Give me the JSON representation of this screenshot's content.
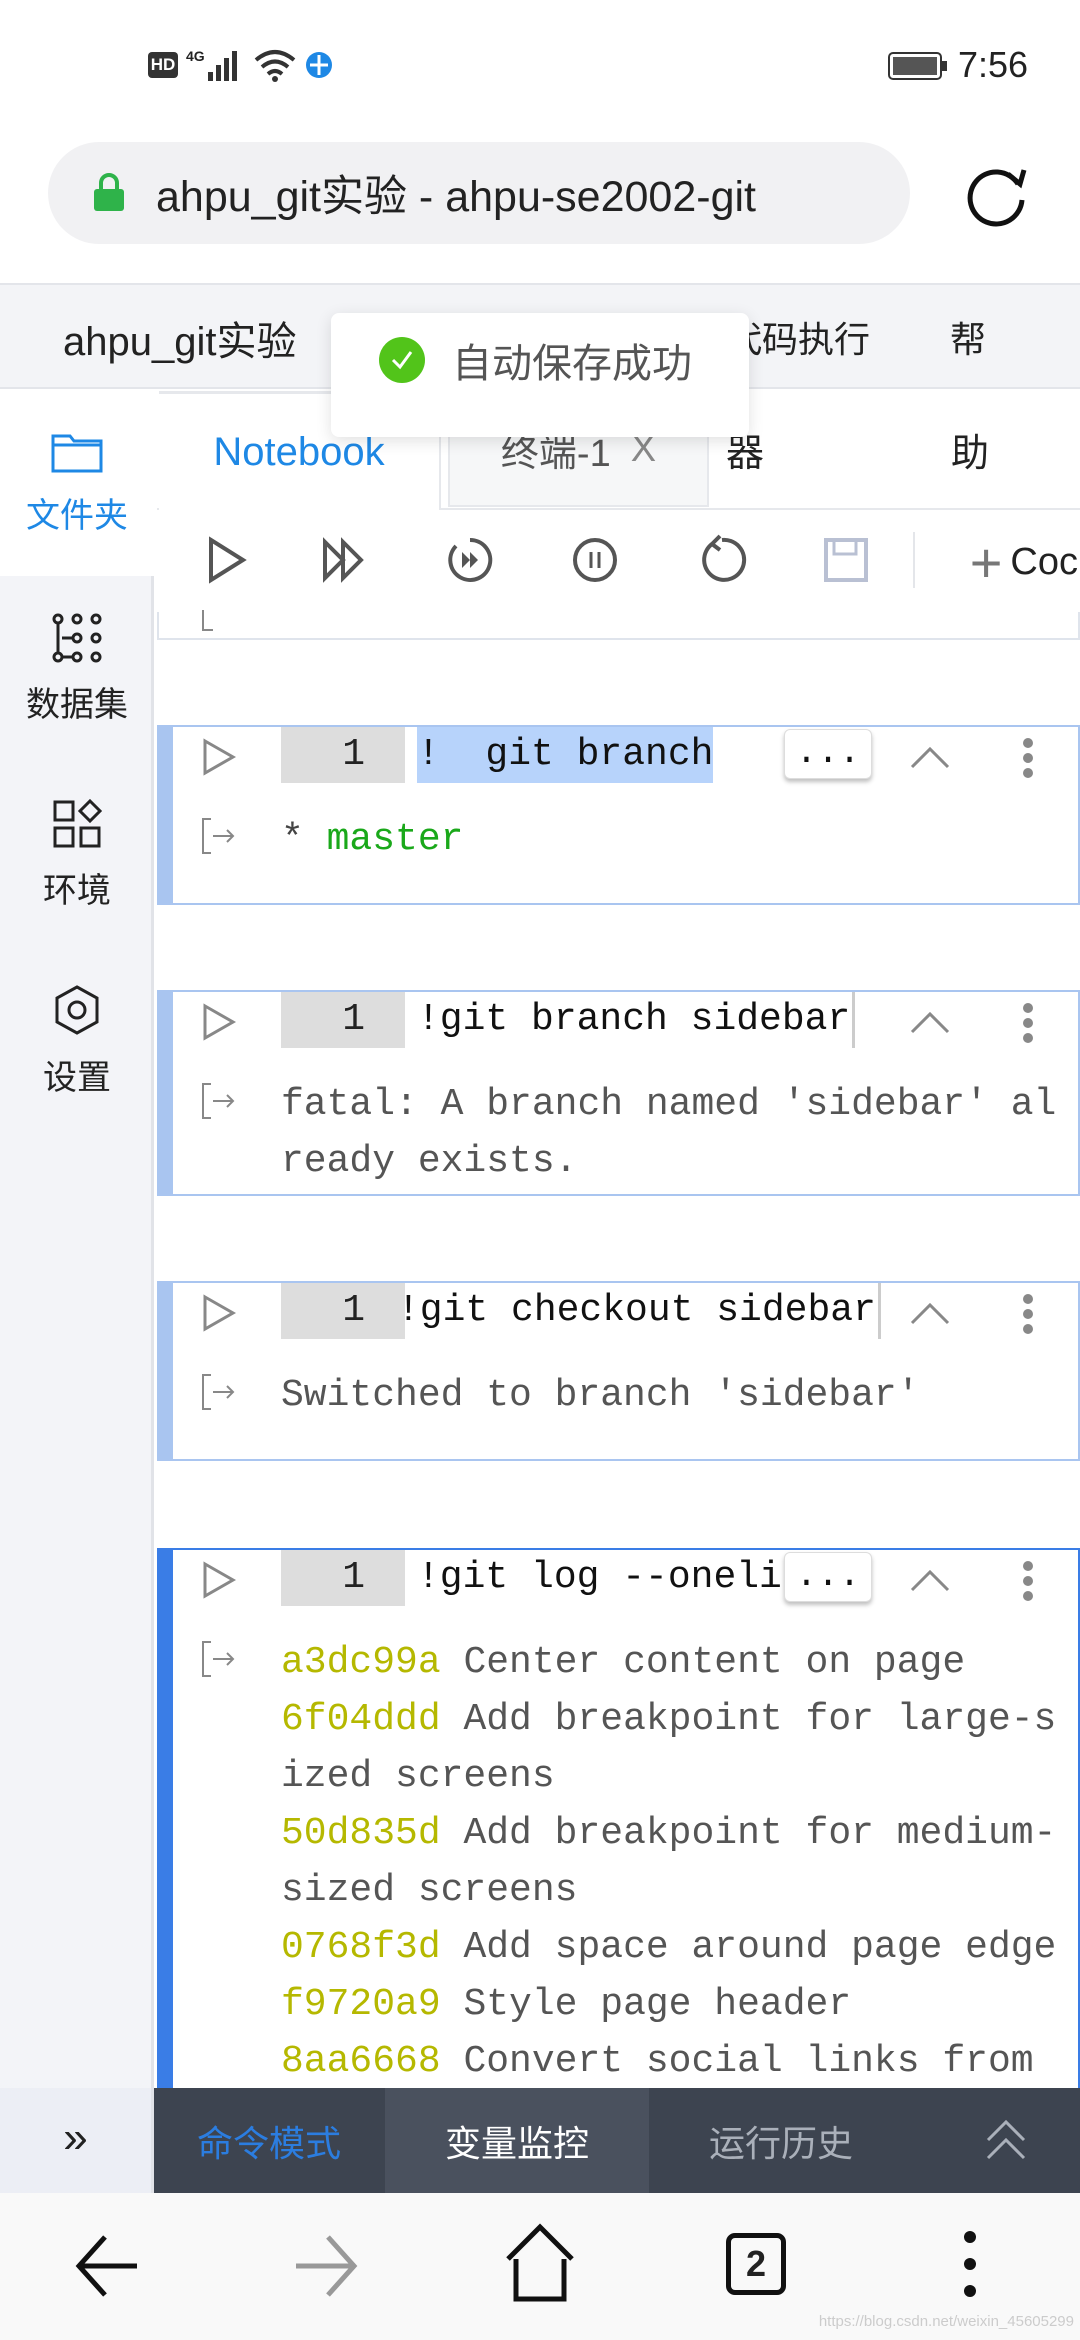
{
  "status_bar": {
    "left_icons": [
      "hd-icon",
      "4g-signal-icon",
      "wifi-icon",
      "browser-icon"
    ],
    "network": "4G",
    "hd": "HD",
    "time": "7:56"
  },
  "browser": {
    "address_text": "ahpu_git实验 - ahpu-se2002-git",
    "tabs_count": "2"
  },
  "menubar": {
    "project": "ahpu_git实验",
    "items": [
      "代码执行",
      "帮助"
    ],
    "partial_items": [
      "代码执行",
      "帮"
    ]
  },
  "toast": {
    "message": "自动保存成功",
    "color": "#52c41a"
  },
  "sidebar": {
    "items": [
      {
        "label": "文件夹",
        "icon": "folder-icon",
        "active": true
      },
      {
        "label": "数据集",
        "icon": "dataset-icon"
      },
      {
        "label": "环境",
        "icon": "environment-icon"
      },
      {
        "label": "设置",
        "icon": "settings-icon"
      }
    ],
    "expand": "»"
  },
  "tabs": {
    "notebook": "Notebook",
    "terminal": "终端-1",
    "close": "X",
    "partial1": "器",
    "partial2": "助"
  },
  "toolbar": {
    "add_label": "Coc"
  },
  "cells": [
    {
      "line": "1",
      "code": "!  git branch",
      "output": [
        {
          "prefix": "* ",
          "text": "master"
        }
      ]
    },
    {
      "line": "1",
      "code": "!git branch sidebar",
      "output_lines": [
        "fatal: A branch named 'sidebar' al",
        "ready exists."
      ]
    },
    {
      "line": "1",
      "code": "!git checkout sidebar",
      "output_lines": [
        "Switched to branch 'sidebar'"
      ]
    },
    {
      "line": "1",
      "code": "!git log --oneli",
      "more": "...",
      "log": [
        {
          "hash": "a3dc99a",
          "msg": "Center content on page"
        },
        {
          "hash": "6f04ddd",
          "msg": "Add breakpoint for large-s",
          "cont": "ized screens"
        },
        {
          "hash": "50d835d",
          "msg": "Add breakpoint for medium-",
          "cont": "sized screens"
        },
        {
          "hash": "0768f3d",
          "msg": "Add space around page edge"
        },
        {
          "hash": "f9720a9",
          "msg": "Style page header"
        },
        {
          "hash": "8aa6668",
          "msg": "Convert social links from"
        }
      ]
    }
  ],
  "more_label": "...",
  "bottom_panel": {
    "tabs": [
      "命令模式",
      "变量监控",
      "运行历史"
    ],
    "active": "命令模式"
  },
  "watermark": "https://blog.csdn.net/weixin_45605299",
  "colors": {
    "accent": "#1e88e5",
    "hash": "#b5b800",
    "master": "#1aa81a",
    "cell_border": "#a9c5f0",
    "active_cell": "#3a7de6"
  }
}
